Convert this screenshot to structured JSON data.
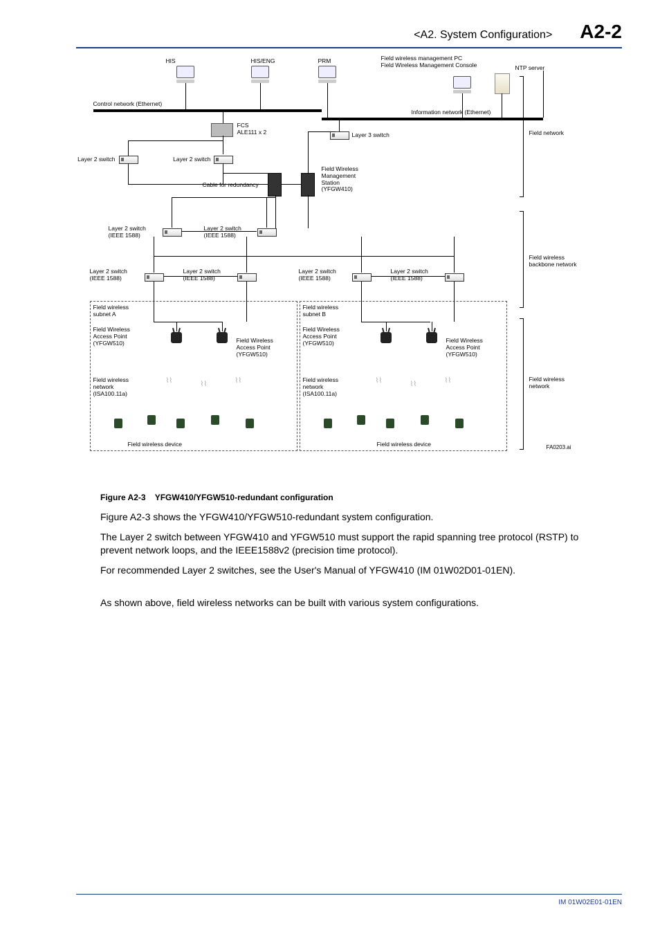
{
  "header": {
    "section": "<A2.  System Configuration>",
    "pagenum": "A2-2"
  },
  "diagram": {
    "top": {
      "his": "HIS",
      "hiseng": "HIS/ENG",
      "prm": "PRM",
      "mgmt_pc": "Field wireless management PC",
      "mgmt_console": "Field Wireless Management Console",
      "ntp": "NTP server"
    },
    "control_net": "Control network (Ethernet)",
    "info_net": "Information network (Ethernet)",
    "fcs": "FCS\nALE111 x 2",
    "l3switch": "Layer 3 switch",
    "l2switch": "Layer 2 switch",
    "l2switch_ieee": "Layer 2 switch\n(IEEE 1588)",
    "cable_redund": "Cable for redundancy",
    "mgmt_station": "Field Wireless\nManagement\nStation\n(YFGW410)",
    "brace_fieldnet": "Field network",
    "brace_backbone": "Field wireless\nbackbone network",
    "brace_wireless": "Field wireless\nnetwork",
    "subnetA": "Field wireless\nsubnet A",
    "subnetB": "Field wireless\nsubnet B",
    "ap": "Field Wireless\nAccess Point\n(YFGW510)",
    "fw_network": "Field wireless\nnetwork\n(ISA100.11a)",
    "fw_device": "Field wireless device",
    "figref": "FA0203.ai"
  },
  "caption": {
    "num": "Figure A2-3",
    "title": "YFGW410/YFGW510-redundant configuration"
  },
  "paras": {
    "p1": "Figure A2-3 shows the YFGW410/YFGW510-redundant system configuration.",
    "p2": "The Layer 2 switch between YFGW410 and YFGW510 must support the rapid spanning tree protocol (RSTP) to prevent network loops, and the IEEE1588v2 (precision time protocol).",
    "p3": "For recommended Layer 2 switches, see the User's Manual of YFGW410 (IM 01W02D01-01EN).",
    "p4": "As shown above, field wireless networks can be built with various system configurations."
  },
  "footer": {
    "docid": "IM 01W02E01-01EN"
  }
}
